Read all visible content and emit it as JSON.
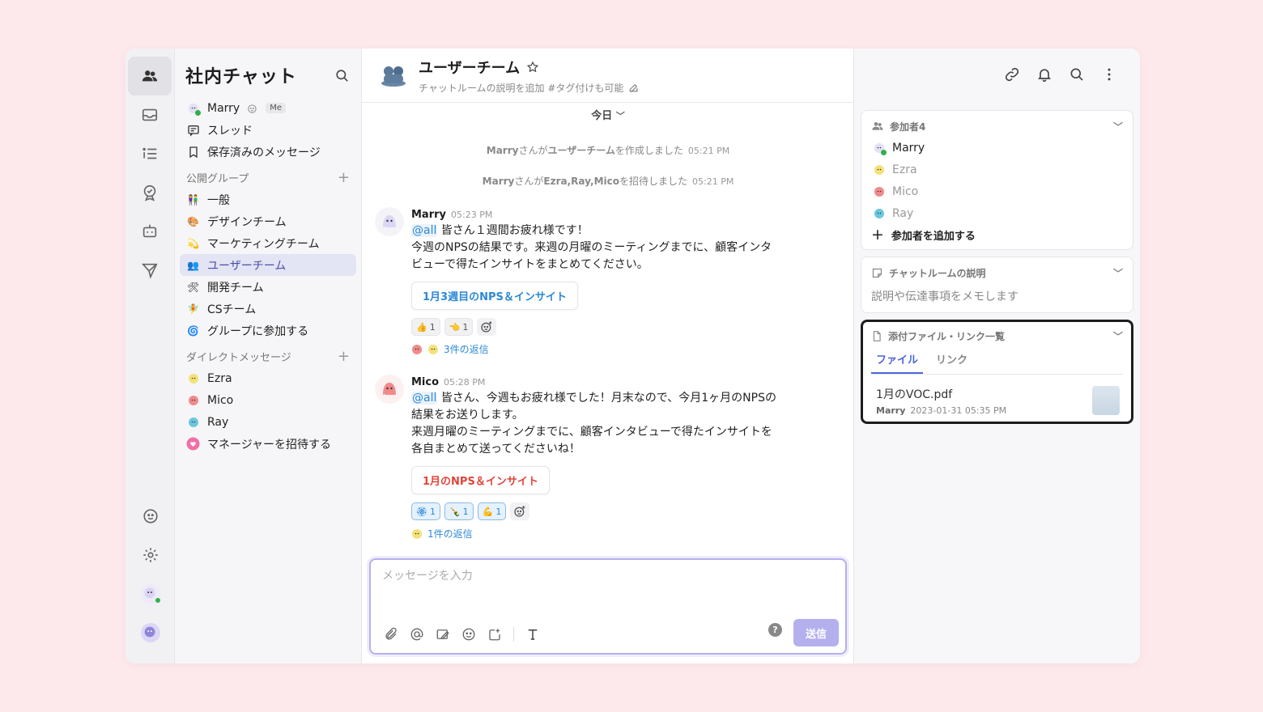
{
  "sidebar": {
    "title": "社内チャット",
    "me": {
      "name": "Marry",
      "badge": "Me"
    },
    "nav": [
      {
        "label": "スレッド",
        "icon": "thread-icon"
      },
      {
        "label": "保存済みのメッセージ",
        "icon": "bookmark-icon"
      }
    ],
    "public_section": "公開グループ",
    "groups": [
      {
        "label": "一般",
        "emoji": "👫"
      },
      {
        "label": "デザインチーム",
        "emoji": "🎨"
      },
      {
        "label": "マーケティングチーム",
        "emoji": "💫"
      },
      {
        "label": "ユーザーチーム",
        "emoji": "👥",
        "active": true
      },
      {
        "label": "開発チーム",
        "emoji": "🛠"
      },
      {
        "label": "CSチーム",
        "emoji": "🧚"
      },
      {
        "label": "グループに参加する",
        "emoji": "🌀"
      }
    ],
    "dm_section": "ダイレクトメッセージ",
    "dms": [
      {
        "label": "Ezra",
        "color": "#f3e27a"
      },
      {
        "label": "Mico",
        "color": "#f08a8a"
      },
      {
        "label": "Ray",
        "color": "#6cc6df"
      },
      {
        "label": "マネージャーを招待する",
        "color": "#f06fa6"
      }
    ]
  },
  "room": {
    "title": "ユーザーチーム",
    "subtitle": "チャットルームの説明を追加 #タグ付けも可能"
  },
  "timeline": {
    "date": "今日",
    "system": [
      {
        "pre": "Marry",
        "mid": "さんが",
        "obj": "ユーザーチーム",
        "post": "を作成しました",
        "time": "05:21 PM"
      },
      {
        "pre": "Marry",
        "mid": "さんが",
        "obj": "Ezra,Ray,Mico",
        "post": "を招待しました",
        "time": "05:21 PM"
      }
    ],
    "messages": [
      {
        "name": "Marry",
        "time": "05:23 PM",
        "mention": "@all",
        "line1": " 皆さん１週間お疲れ様です！",
        "line2": "今週のNPSの結果です。来週の月曜のミーティングまでに、顧客インタ",
        "line3": "ビューで得たインサイトをまとめてください。",
        "card": "1月3週目のNPS＆インサイト",
        "card_color": "#2d88d6",
        "reactions": [
          {
            "emoji": "👍",
            "count": "1"
          },
          {
            "emoji": "👈",
            "count": "1"
          }
        ],
        "replies": "3件の返信"
      },
      {
        "name": "Mico",
        "time": "05:28 PM",
        "mention": "@all",
        "line1": " 皆さん、今週もお疲れ様でした！月末なので、今月1ヶ月のNPSの",
        "line2": "結果をお送りします。",
        "line3": "来週月曜のミーティングまでに、顧客インタビューで得たインサイトを",
        "line4": "各自まとめて送ってくださいね！",
        "card": "1月のNPS＆インサイト",
        "card_color": "#e0453a",
        "reactions": [
          {
            "emoji": "🏵",
            "count": "1"
          },
          {
            "emoji": "🍾",
            "count": "1"
          },
          {
            "emoji": "💪",
            "count": "1"
          }
        ],
        "replies": "1件の返信"
      }
    ]
  },
  "composer": {
    "placeholder": "メッセージを入力",
    "send": "送信",
    "help": "?"
  },
  "right": {
    "members_title": "参加者4",
    "members": [
      "Marry",
      "Ezra",
      "Mico",
      "Ray"
    ],
    "add_member": "参加者を追加する",
    "desc_title": "チャットルームの説明",
    "desc_placeholder": "説明や伝達事項をメモします",
    "files_title": "添付ファイル・リンク一覧",
    "tabs": [
      "ファイル",
      "リンク"
    ],
    "file": {
      "name": "1月のVOC.pdf",
      "owner": "Marry",
      "date": "2023-01-31 05:35 PM"
    }
  },
  "colors": {
    "accent": "#4a4fa8",
    "link": "#2d88d6",
    "send": "#b4b0ee",
    "background": "#fde8ec"
  }
}
